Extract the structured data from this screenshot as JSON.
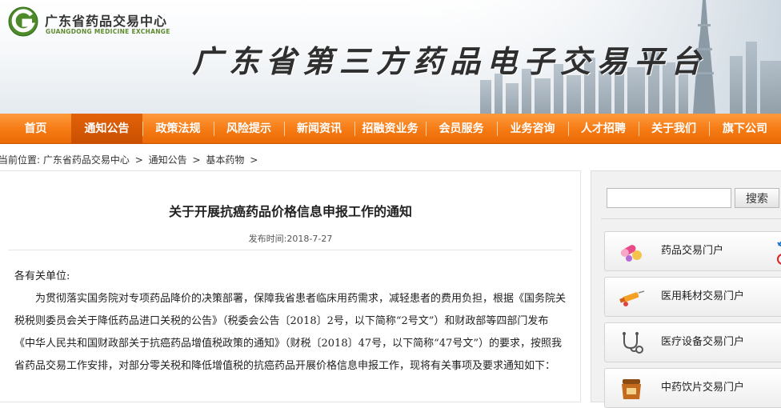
{
  "header": {
    "logo_cn": "广东省药品交易中心",
    "logo_en": "GUANGDONG MEDICINE EXCHANGE",
    "platform_title": "广东省第三方药品电子交易平台"
  },
  "nav": {
    "items": [
      {
        "label": "首页"
      },
      {
        "label": "通知公告"
      },
      {
        "label": "政策法规"
      },
      {
        "label": "风险提示"
      },
      {
        "label": "新闻资讯"
      },
      {
        "label": "招融资业务"
      },
      {
        "label": "会员服务"
      },
      {
        "label": "业务咨询"
      },
      {
        "label": "人才招聘"
      },
      {
        "label": "关于我们"
      },
      {
        "label": "旗下公司"
      }
    ],
    "active": "通知公告"
  },
  "breadcrumb": {
    "prefix": "当前位置:",
    "items": [
      "广东省药品交易中心",
      "通知公告",
      "基本药物"
    ],
    "separator": ">"
  },
  "article": {
    "title": "关于开展抗癌药品价格信息申报工作的通知",
    "publish_label": "发布时间:",
    "publish_date": "2018-7-27",
    "greeting": "各有关单位:",
    "paragraph": "为贯彻落实国务院对专项药品降价的决策部署，保障我省患者临床用药需求，减轻患者的费用负担，根据《国务院关税税则委员会关于降低药品进口关税的公告》（税委会公告〔2018〕2号，以下简称“2号文”）和财政部等四部门发布《中华人民共和国财政部关于抗癌药品增值税政策的通知》（财税〔2018〕47号，以下简称“47号文”）的要求，按照我省药品交易工作安排，对部分零关税和降低增值税的抗癌药品开展价格信息申报工作，现将有关事项及要求通知如下："
  },
  "sidebar": {
    "search_placeholder": "",
    "search_button": "搜索",
    "portals": [
      {
        "label": "药品交易门户",
        "icon": "pills-icon"
      },
      {
        "label": "医用耗材交易门户",
        "icon": "syringe-icon"
      },
      {
        "label": "医疗设备交易门户",
        "icon": "stethoscope-icon"
      },
      {
        "label": "中药饮片交易门户",
        "icon": "herbal-jar-icon"
      }
    ]
  },
  "colors": {
    "nav_orange": "#f57a14",
    "nav_active": "#c94f00",
    "logo_green": "#5d8a2e"
  }
}
